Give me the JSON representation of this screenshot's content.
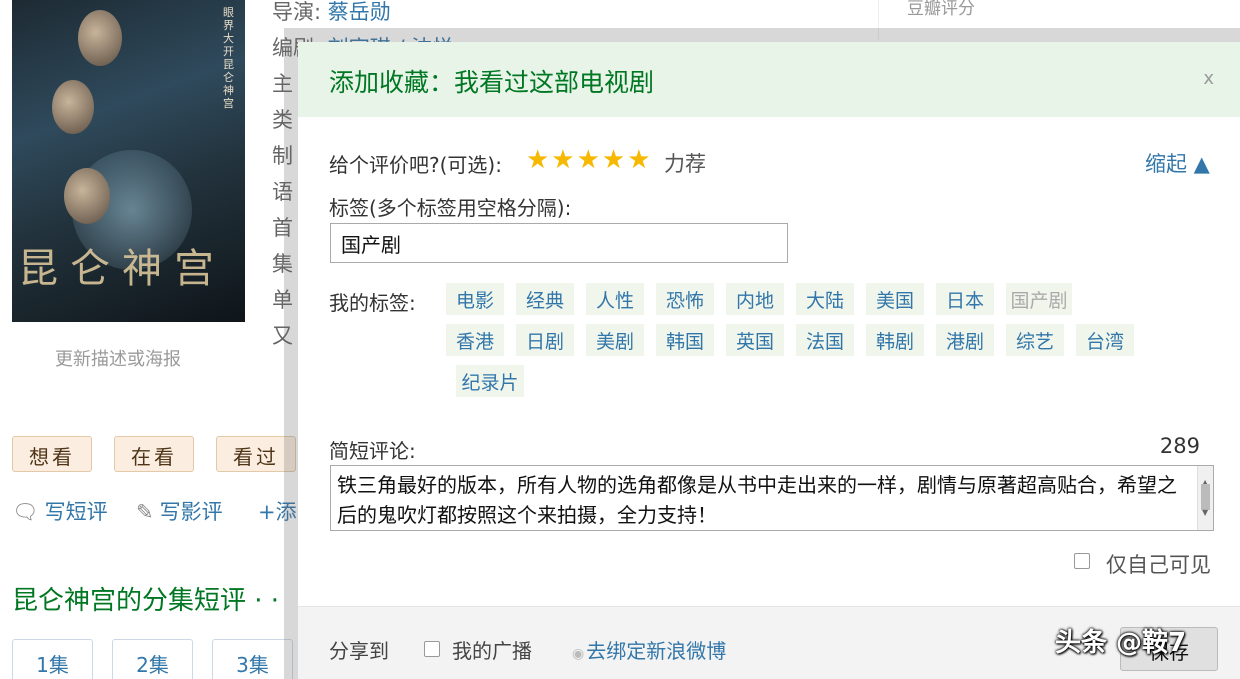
{
  "background": {
    "poster": {
      "vertical_text": "眼界大开 昆仑神宫",
      "title_art": "昆仑神宫"
    },
    "update_link": "更新描述或海报",
    "info": [
      {
        "label": "导演:",
        "value": "蔡岳勋"
      },
      {
        "label": "编剧:",
        "value": "刘宇琪 / 沈悦"
      },
      {
        "label": "主"
      },
      {
        "label": "类"
      },
      {
        "label": "制"
      },
      {
        "label": "语"
      },
      {
        "label": "首"
      },
      {
        "label": "集"
      },
      {
        "label": "单"
      },
      {
        "label": "又"
      }
    ],
    "douban_rating_label": "豆瓣评分",
    "status_buttons": [
      "想看",
      "在看",
      "看过"
    ],
    "actions": {
      "short_review": "写短评",
      "long_review": "写影评",
      "add": "+添"
    },
    "episodes_title": "昆仑神宫的分集短评 · ·",
    "episode_buttons": [
      "1集",
      "2集",
      "3集"
    ]
  },
  "dialog": {
    "title": "添加收藏：我看过这部电视剧",
    "close": "x",
    "rating_label": "给个评价吧?(可选):",
    "stars": "★★★★★",
    "rating_value": 5,
    "rating_word": "力荐",
    "collapse": "缩起 ▲",
    "tags_label": "标签(多个标签用空格分隔):",
    "tags_value": "国产剧",
    "my_tags_label": "我的标签:",
    "my_tags": [
      "电影",
      "经典",
      "人性",
      "恐怖",
      "内地",
      "大陆",
      "美国",
      "日本",
      "国产剧",
      "香港",
      "日剧",
      "美剧",
      "韩国",
      "英国",
      "法国",
      "韩剧",
      "港剧",
      "综艺",
      "台湾",
      "纪录片"
    ],
    "comment_label": "简短评论:",
    "comment_count": "289",
    "comment_text": "铁三角最好的版本，所有人物的选角都像是从书中走出来的一样，剧情与原著超高贴合，希望之后的鬼吹灯都按照这个来拍摄，全力支持！",
    "private_label": "仅自己可见",
    "share_label": "分享到",
    "broadcast_label": "我的广播",
    "weibo_link": "去绑定新浪微博",
    "save_button": "保存"
  },
  "watermark": "头条 @鞍7"
}
